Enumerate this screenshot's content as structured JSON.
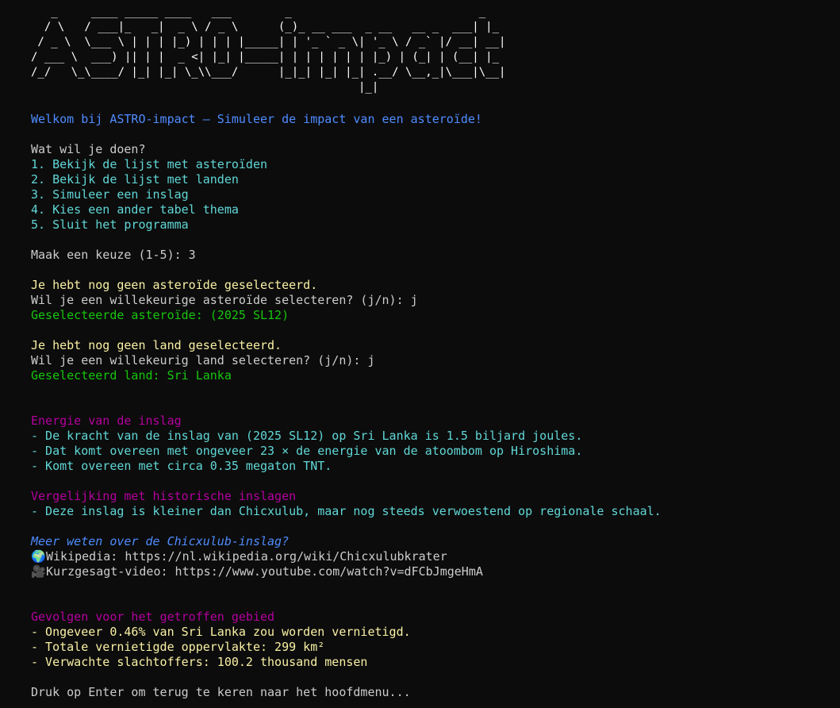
{
  "banner": "   _     ____ _____ ____   ___        _                            _   \n  / \\   / ___|_   _|  _ \\ / _ \\      (_)_ __ ___  _ __   __ _  ___| |_ \n / _ \\  \\___ \\ | | | |_) | | | |_____| | '_ ` _ \\| '_ \\ / _` |/ __| __|\n/ ___ \\  ___) || | |  _ <| |_| |_____| | | | | | | |_) | (_| | (__| |_ \n/_/   \\_\\____/ |_| |_| \\_\\\\___/      |_|_| |_| |_| .__/ \\__,_|\\___|\\__|\n                                                 |_|                  ",
  "welcome": "Welkom bij ASTRO-impact – Simuleer de impact van een asteroïde!",
  "menu": {
    "prompt": "Wat wil je doen?",
    "items": [
      "1. Bekijk de lijst met asteroïden",
      "2. Bekijk de lijst met landen",
      "3. Simuleer een inslag",
      "4. Kies een ander tabel thema",
      "5. Sluit het programma"
    ],
    "choice_prompt": "Maak een keuze (1-5): 3"
  },
  "asteroid": {
    "warning": "Je hebt nog geen asteroïde geselecteerd.",
    "question": "Wil je een willekeurige asteroïde selecteren? (j/n): j",
    "selected": "Geselecteerde asteroïde: (2025 SL12)"
  },
  "country": {
    "warning": "Je hebt nog geen land geselecteerd.",
    "question": "Wil je een willekeurig land selecteren? (j/n): j",
    "selected": "Geselecteerd land: Sri Lanka"
  },
  "energy": {
    "heading": "Energie van de inslag",
    "lines": [
      "- De kracht van de inslag van (2025 SL12) op Sri Lanka is 1.5 biljard joules.",
      "- Dat komt overeen met ongeveer 23 × de energie van de atoombom op Hiroshima.",
      "- Komt overeen met circa 0.35 megaton TNT."
    ]
  },
  "comparison": {
    "heading": "Vergelijking met historische inslagen",
    "line": "- Deze inslag is kleiner dan Chicxulub, maar nog steeds verwoestend op regionale schaal."
  },
  "more_info": {
    "heading": "Meer weten over de Chicxulub-inslag?",
    "wiki_icon": "🌍",
    "wiki_label": "Wikipedia: https://nl.wikipedia.org/wiki/Chicxulubkrater",
    "video_icon": "🎥",
    "video_label": "Kurzgesagt-video: https://www.youtube.com/watch?v=dFCbJmgeHmA"
  },
  "consequences": {
    "heading": "Gevolgen voor het getroffen gebied",
    "lines": [
      "- Ongeveer 0.46% van Sri Lanka zou worden vernietigd.",
      "- Totale vernietigde oppervlakte: 299 km²",
      "- Verwachte slachtoffers: 100.2 thousand mensen"
    ]
  },
  "footer_prompt": "Druk op Enter om terug te keren naar het hoofdmenu...",
  "colors": {
    "background": "#0c0c0c",
    "text": "#cccccc",
    "blue": "#4f8cff",
    "cyan": "#61d6d6",
    "yellow": "#f9f1a5",
    "green": "#16c60c",
    "magenta": "#b4009e"
  }
}
